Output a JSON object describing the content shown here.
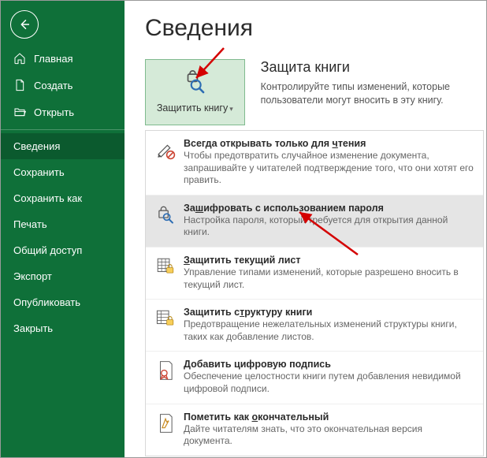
{
  "sidebar": {
    "items": [
      {
        "label": "Главная",
        "icon": "home"
      },
      {
        "label": "Создать",
        "icon": "file"
      },
      {
        "label": "Открыть",
        "icon": "folder"
      },
      {
        "label": "Сведения",
        "icon": ""
      },
      {
        "label": "Сохранить",
        "icon": ""
      },
      {
        "label": "Сохранить как",
        "icon": ""
      },
      {
        "label": "Печать",
        "icon": ""
      },
      {
        "label": "Общий доступ",
        "icon": ""
      },
      {
        "label": "Экспорт",
        "icon": ""
      },
      {
        "label": "Опубликовать",
        "icon": ""
      },
      {
        "label": "Закрыть",
        "icon": ""
      }
    ]
  },
  "page": {
    "title": "Сведения"
  },
  "protect": {
    "button_label": "Защитить книгу",
    "heading": "Защита книги",
    "description": "Контролируйте типы изменений, которые пользователи могут вносить в эту книгу."
  },
  "menu": [
    {
      "title_pre": "Всегда открывать только для ",
      "title_ul": "ч",
      "title_post": "тения",
      "desc": "Чтобы предотвратить случайное изменение документа, запрашивайте у читателей подтверждение того, что они хотят его править.",
      "icon": "pencil-block"
    },
    {
      "title_pre": "За",
      "title_ul": "ш",
      "title_post": "ифровать с использованием пароля",
      "desc": "Настройка пароля, который требуется для открытия данной книги.",
      "icon": "lock-search",
      "highlight": true
    },
    {
      "title_pre": "",
      "title_ul": "З",
      "title_post": "ащитить текущий лист",
      "desc": "Управление типами изменений, которые разрешено вносить в текущий лист.",
      "icon": "sheet-lock"
    },
    {
      "title_pre": "Защитить с",
      "title_ul": "т",
      "title_post": "руктуру книги",
      "desc": "Предотвращение нежелательных изменений структуры книги, таких как добавление листов.",
      "icon": "book-lock"
    },
    {
      "title_pre": "",
      "title_ul": "Д",
      "title_post": "обавить цифровую подпись",
      "desc": "Обеспечение целостности книги путем добавления невидимой цифровой подписи.",
      "icon": "ribbon"
    },
    {
      "title_pre": "Пометить как ",
      "title_ul": "о",
      "title_post": "кончательный",
      "desc": "Дайте читателям знать, что это окончательная версия документа.",
      "icon": "final"
    }
  ]
}
